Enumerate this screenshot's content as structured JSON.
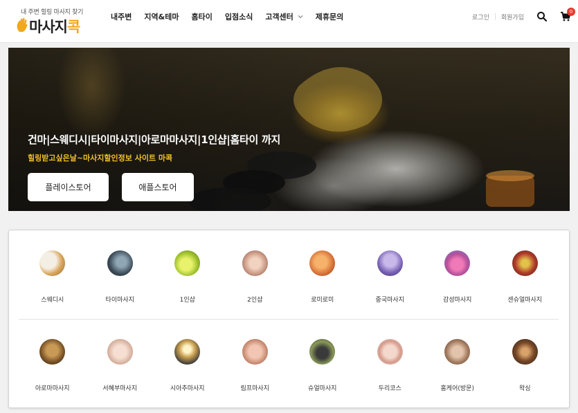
{
  "header": {
    "logo_tagline": "내 주변 힐링 마사지 찾기",
    "logo_word_main": "마사지",
    "logo_word_accent": "콕",
    "nav": [
      {
        "label": "내주변"
      },
      {
        "label": "지역&테마"
      },
      {
        "label": "홈타이"
      },
      {
        "label": "입점소식"
      },
      {
        "label": "고객센터"
      },
      {
        "label": "제휴문의"
      }
    ],
    "login_label": "로그인",
    "signup_label": "회원가입",
    "search_icon": "search-icon",
    "cart_icon": "cart-icon",
    "cart_count": "0"
  },
  "hero": {
    "title": "건마|스웨디시|타이마사지|아로마마사지|1인샵|홈타이 까지",
    "subtitle": "힐링받고싶은날~마사지할인정보 사이트 마콕",
    "play_store_label": "플레이스토어",
    "app_store_label": "애플스토어"
  },
  "categories_row1": [
    {
      "label": "스웨디시"
    },
    {
      "label": "타이마사지"
    },
    {
      "label": "1인샵"
    },
    {
      "label": "2인샵"
    },
    {
      "label": "로미로미"
    },
    {
      "label": "중국마사지"
    },
    {
      "label": "감성마사지"
    },
    {
      "label": "센슈얼마사지"
    }
  ],
  "categories_row2": [
    {
      "label": "아로마마사지"
    },
    {
      "label": "서혜부마사지"
    },
    {
      "label": "시아추마사지"
    },
    {
      "label": "림프마사지"
    },
    {
      "label": "슈얼마사지"
    },
    {
      "label": "두리코스"
    },
    {
      "label": "홈케어(방문)"
    },
    {
      "label": "왁싱"
    }
  ],
  "colors": {
    "accent": "#f0a81c",
    "hero_subtitle": "#f1c02c",
    "badge": "#e8392e"
  }
}
